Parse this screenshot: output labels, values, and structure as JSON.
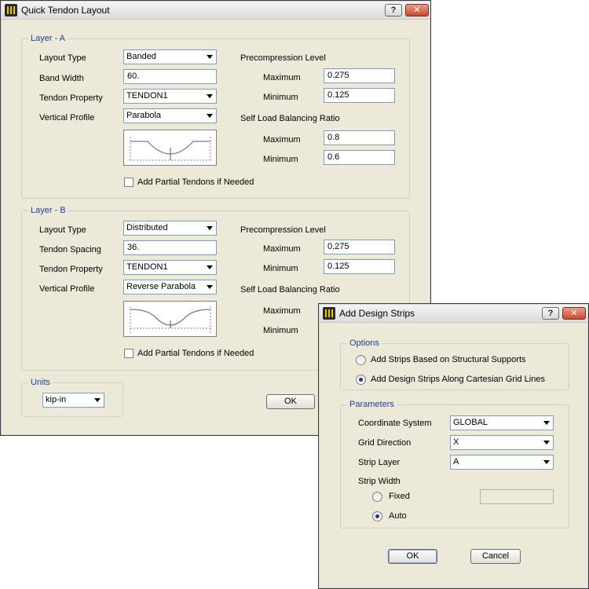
{
  "quick_tendon": {
    "title": "Quick Tendon Layout",
    "title_buttons": {
      "help": "?",
      "close": "✕"
    },
    "layer_a": {
      "legend": "Layer - A",
      "labels": {
        "layout_type": "Layout Type",
        "band_width": "Band Width",
        "tendon_property": "Tendon Property",
        "vertical_profile": "Vertical Profile"
      },
      "layout_type": "Banded",
      "band_width": "60.",
      "tendon_property": "TENDON1",
      "vertical_profile": "Parabola",
      "precompression_title": "Precompression Level",
      "self_load_title": "Self Load Balancing Ratio",
      "max_label": "Maximum",
      "min_label": "Minimum",
      "precompression_max": "0.275",
      "precompression_min": "0.125",
      "self_load_max": "0.8",
      "self_load_min": "0.6",
      "partial_tendons": "Add Partial Tendons if Needed"
    },
    "layer_b": {
      "legend": "Layer - B",
      "labels": {
        "layout_type": "Layout Type",
        "tendon_spacing": "Tendon Spacing",
        "tendon_property": "Tendon Property",
        "vertical_profile": "Vertical Profile"
      },
      "layout_type": "Distributed",
      "tendon_spacing": "36.",
      "tendon_property": "TENDON1",
      "vertical_profile": "Reverse Parabola",
      "precompression_title": "Precompression Level",
      "self_load_title": "Self Load Balancing Ratio",
      "max_label": "Maximum",
      "min_label": "Minimum",
      "precompression_max": "0.275",
      "precompression_min": "0.125",
      "partial_tendons": "Add Partial Tendons if Needed"
    },
    "units": {
      "legend": "Units",
      "value": "kip-in"
    },
    "ok_label": "OK"
  },
  "design_strips": {
    "title": "Add Design Strips",
    "title_buttons": {
      "help": "?",
      "close": "✕"
    },
    "options": {
      "legend": "Options",
      "option1": "Add Strips Based on Structural Supports",
      "option2": "Add Design Strips Along Cartesian Grid Lines",
      "selected": 2
    },
    "parameters": {
      "legend": "Parameters",
      "coordinate_system_label": "Coordinate System",
      "coordinate_system": "GLOBAL",
      "grid_direction_label": "Grid Direction",
      "grid_direction": "X",
      "strip_layer_label": "Strip Layer",
      "strip_layer": "A",
      "strip_width_label": "Strip Width",
      "fixed_label": "Fixed",
      "auto_label": "Auto",
      "width_selected": "Auto",
      "fixed_value": ""
    },
    "ok_label": "OK",
    "cancel_label": "Cancel"
  },
  "colors": {
    "legend_text": "#1f3f9f",
    "dialog_bg": "#ece9d8",
    "input_border": "#7f9db9"
  }
}
